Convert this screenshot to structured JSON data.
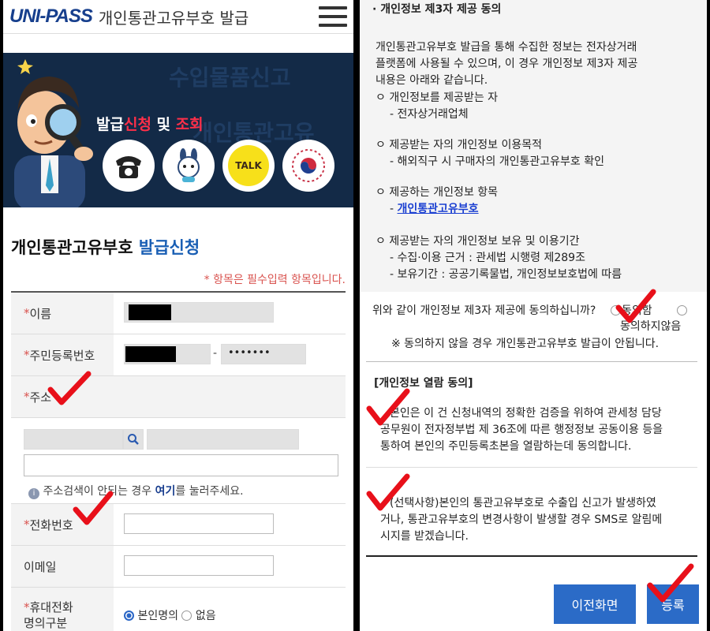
{
  "left": {
    "header": {
      "logo": "UNI-PASS",
      "title": "개인통관고유부호 발급"
    },
    "banner": {
      "bg_text_1": "수입물품신고",
      "bg_text_2": "개인통관고유",
      "title_parts": [
        "발급",
        "신청",
        " 및 ",
        "조회"
      ],
      "icons": [
        "telephone-icon",
        "mascot-icon",
        "kakaotalk-icon",
        "government-emblem-icon"
      ],
      "talk_label": "TALK"
    },
    "form": {
      "title_prefix": "개인통관고유부호",
      "title_accent": "발급신청",
      "required_note": "* 항목은 필수입력 항목입니다.",
      "fields": {
        "name": {
          "star": "*",
          "label": "이름"
        },
        "rrn": {
          "star": "*",
          "label": "주민등록번호",
          "separator": "-",
          "masked_value": "•••••••"
        },
        "address": {
          "star": "*",
          "label": "주소",
          "note_pre": "주소검색이 안되는 경우 ",
          "note_link": "여기",
          "note_post": "를 눌러주세요."
        },
        "phone": {
          "star": "*",
          "label": "전화번호"
        },
        "email": {
          "label": "이메일"
        },
        "mobile": {
          "star": "*",
          "label_1": "휴대전화",
          "label_2": "명의구분",
          "options": [
            "본인명의",
            "없음"
          ],
          "selected": "본인명의"
        }
      }
    }
  },
  "right": {
    "section1": {
      "title": "· 개인정보 제3자 제공 동의",
      "intro": [
        "개인통관고유부호 발급을 통해 수집한 정보는 전자상거래",
        "플랫폼에 사용될 수 있으며, 이 경우 개인정보 제3자 제공",
        "내용은 아래와 같습니다."
      ],
      "items": [
        {
          "head": "ㅇ 개인정보를 제공받는 자",
          "detail": "- 전자상거래업체"
        },
        {
          "head": "ㅇ 제공받는 자의 개인정보 이용목적",
          "detail": "- 해외직구 시 구매자의 개인통관고유부호 확인"
        },
        {
          "head": "ㅇ 제공하는 개인정보 항목",
          "detail_prefix": "- ",
          "detail_link": "개인통관고유부호"
        },
        {
          "head": "ㅇ 제공받는 자의 개인정보 보유 및 이용기간",
          "detail": "- 수집·이용 근거 : 관세법 시행령 제289조",
          "detail_2": "- 보유기간 : 공공기록물법, 개인정보보호법에 따름"
        }
      ],
      "question": "위와 같이 개인정보 제3자 제공에 동의하십니까?",
      "agree": "동의함",
      "disagree": "동의하지않음",
      "warning": "※ 동의하지 않을 경우 개인통관고유부호 발급이 안됩니다."
    },
    "section2": {
      "title": "[개인정보 열람 동의]",
      "consent_text": [
        "본인은 이 건 신청내역의 정확한 검증을 위하여 관세청 담당",
        "공무원이 전자정부법 제 36조에 따른 행정정보 공동이용 등을",
        "통하여 본인의 주민등록초본을 열람하는데 동의합니다."
      ],
      "optional_text": [
        "(선택사항)본인의 통관고유부호로 수출입 신고가 발생하였",
        "거나, 통관고유부호의 변경사항이 발생할 경우 SMS로 알림메",
        "시지를 받겠습니다."
      ]
    },
    "buttons": {
      "prev": "이전화면",
      "submit": "등록"
    }
  },
  "colors": {
    "accent_blue": "#2b6bc7",
    "required_red": "#d9534f",
    "checkmark_red": "#e8101a",
    "banner_navy": "#132a47"
  }
}
